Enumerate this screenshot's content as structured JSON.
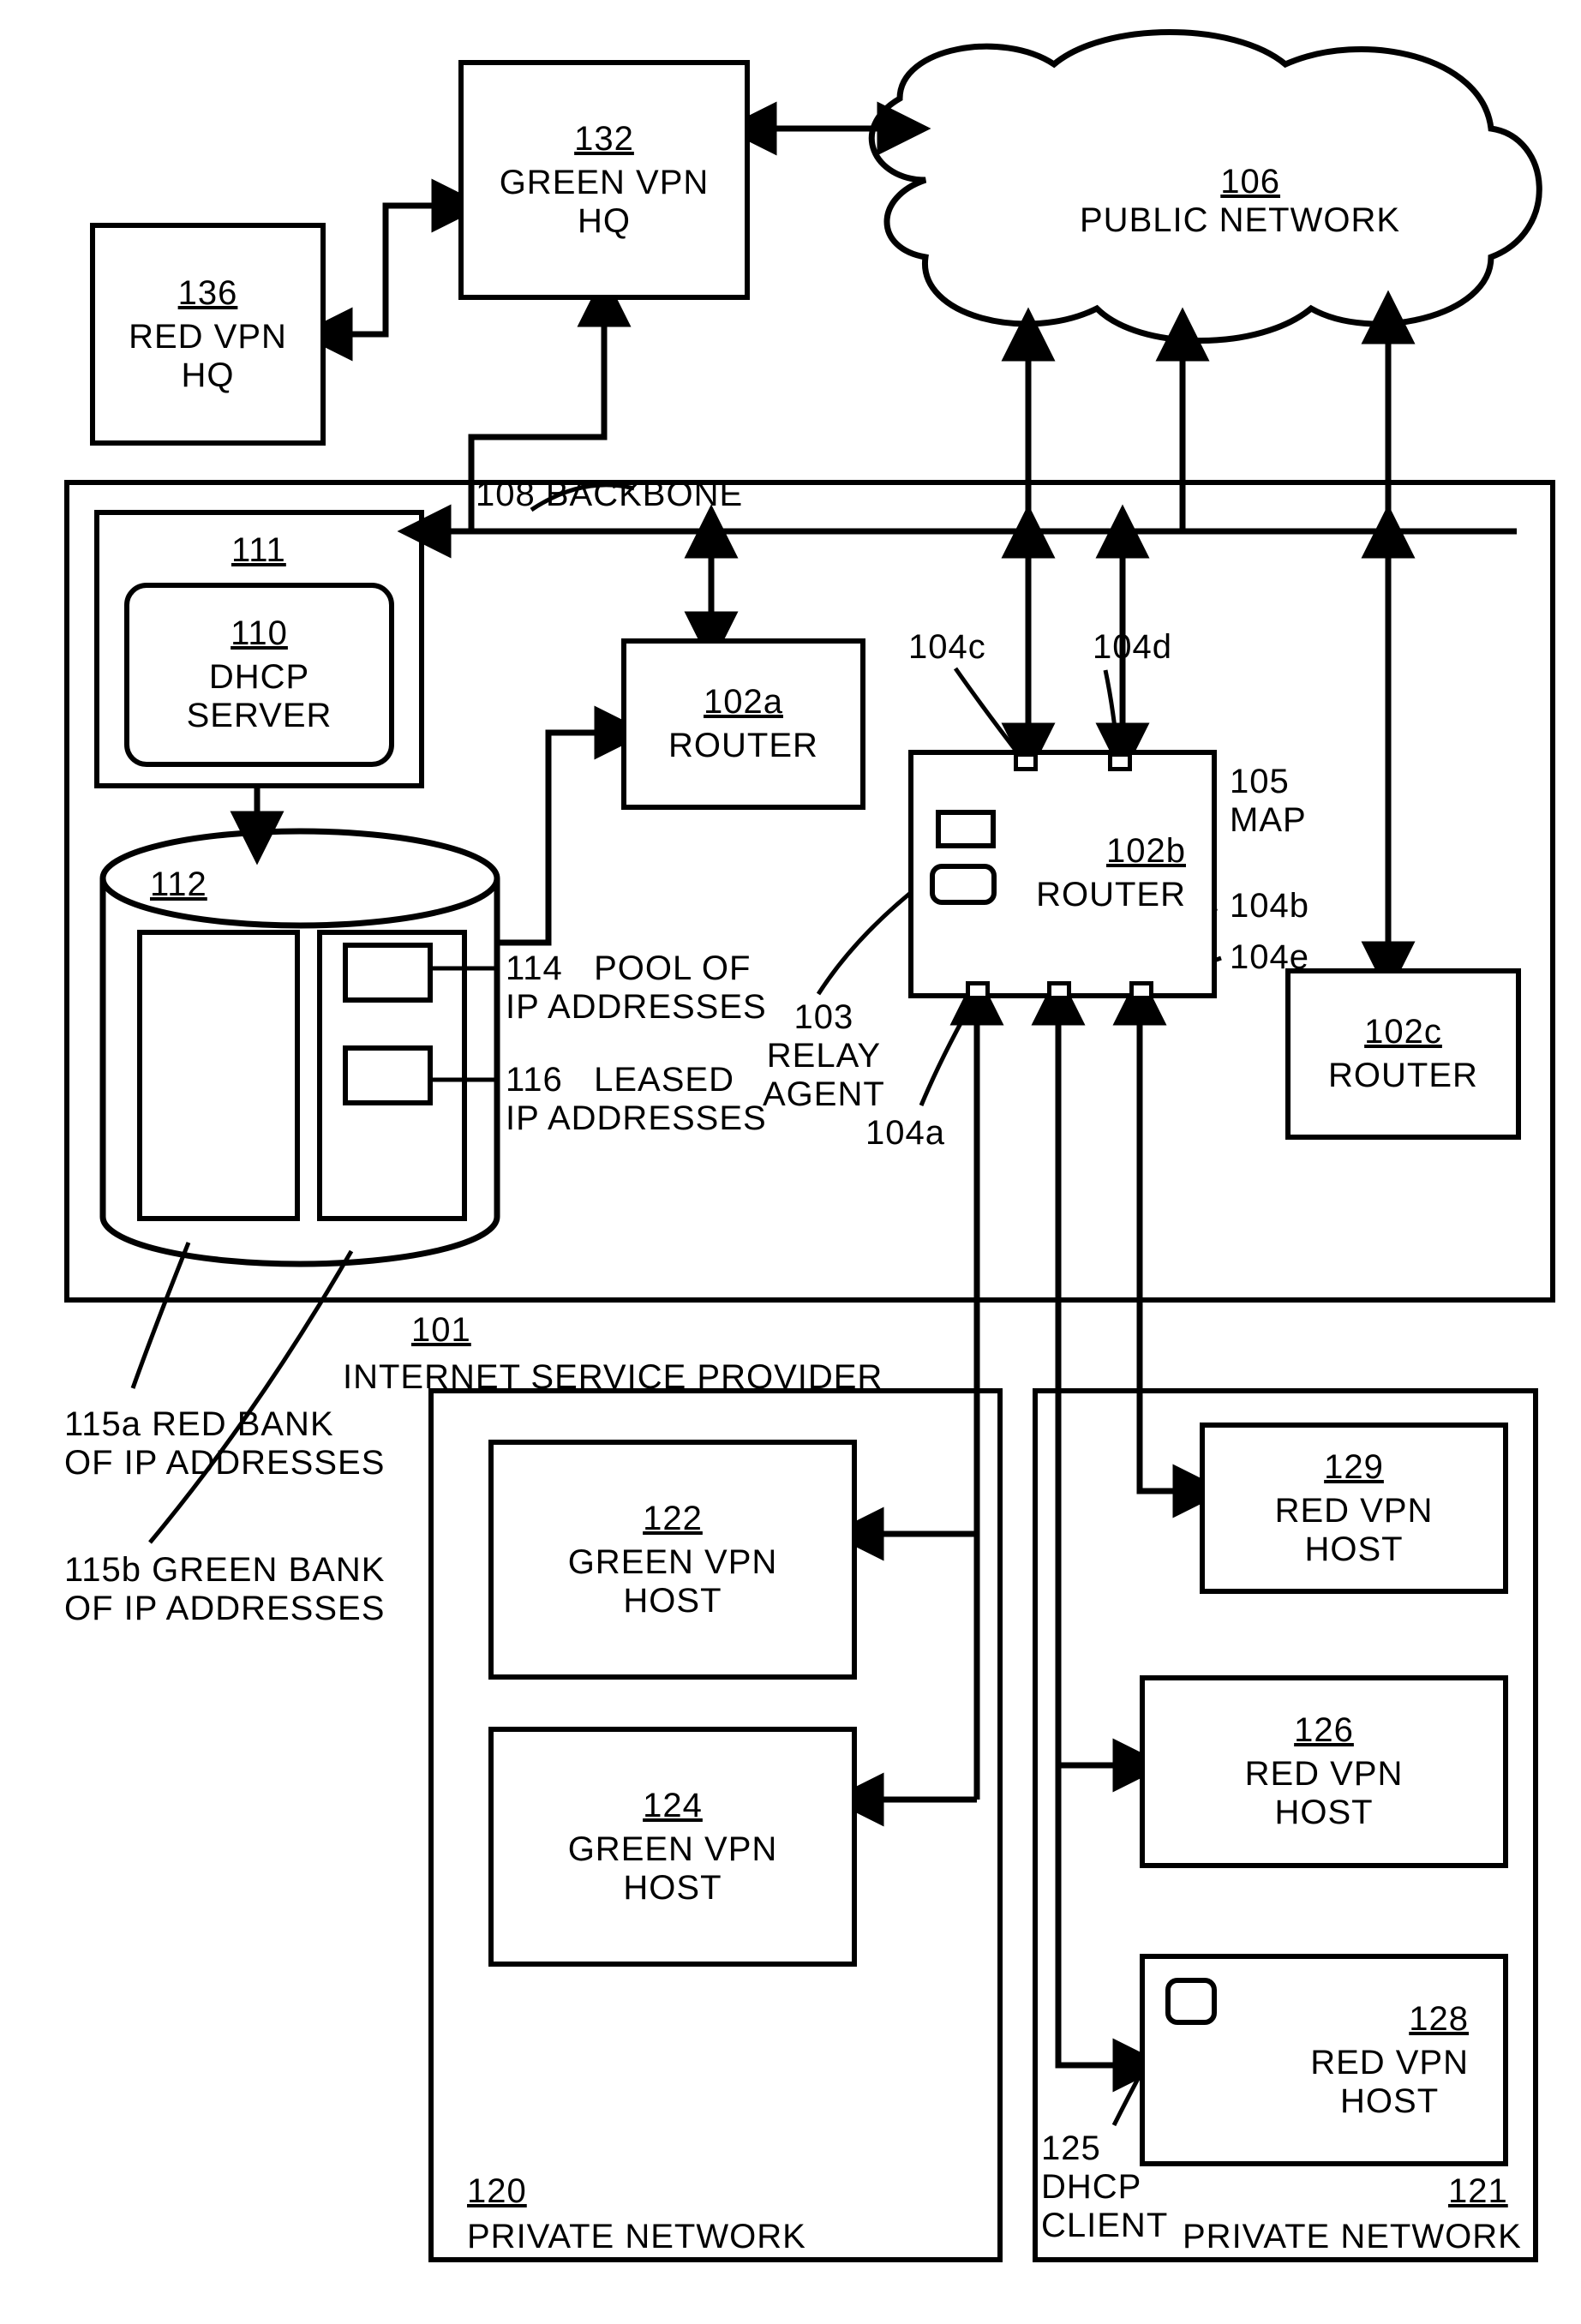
{
  "nodes": {
    "n106": {
      "ref": "106",
      "label": "PUBLIC NETWORK"
    },
    "n132": {
      "ref": "132",
      "label": "GREEN VPN\nHQ"
    },
    "n136": {
      "ref": "136",
      "label": "RED VPN\nHQ"
    },
    "n111": {
      "ref": "111"
    },
    "n110": {
      "ref": "110",
      "label": "DHCP\nSERVER"
    },
    "n112": {
      "ref": "112"
    },
    "n102a": {
      "ref": "102a",
      "label": "ROUTER"
    },
    "n102b": {
      "ref": "102b",
      "label": "ROUTER"
    },
    "n102c": {
      "ref": "102c",
      "label": "ROUTER"
    },
    "n122": {
      "ref": "122",
      "label": "GREEN VPN\nHOST"
    },
    "n124": {
      "ref": "124",
      "label": "GREEN VPN\nHOST"
    },
    "n126": {
      "ref": "126",
      "label": "RED VPN\nHOST"
    },
    "n128": {
      "ref": "128",
      "label": "RED VPN\nHOST"
    },
    "n129": {
      "ref": "129",
      "label": "RED VPN\nHOST"
    },
    "n120": {
      "ref": "120",
      "label": "PRIVATE NETWORK"
    },
    "n121": {
      "ref": "121",
      "label": "PRIVATE NETWORK"
    },
    "n101": {
      "ref": "101",
      "label": "INTERNET SERVICE PROVIDER"
    }
  },
  "annotations": {
    "a108": {
      "ref": "108",
      "label": "BACKBONE"
    },
    "a114": {
      "ref": "114",
      "label": "POOL OF\nIP ADDRESSES"
    },
    "a116": {
      "ref": "116",
      "label": "LEASED\nIP ADDRESSES"
    },
    "a115a": {
      "ref": "115a",
      "label": "RED BANK\nOF IP ADDRESSES"
    },
    "a115b": {
      "ref": "115b",
      "label": "GREEN BANK\nOF IP ADDRESSES"
    },
    "a103": {
      "ref": "103",
      "label": "RELAY\nAGENT"
    },
    "a104a": "104a",
    "a104b": "104b",
    "a104c": "104c",
    "a104d": "104d",
    "a104e": "104e",
    "a105": {
      "ref": "105",
      "label": "MAP"
    },
    "a125": {
      "ref": "125",
      "label": "DHCP\nCLIENT"
    }
  }
}
